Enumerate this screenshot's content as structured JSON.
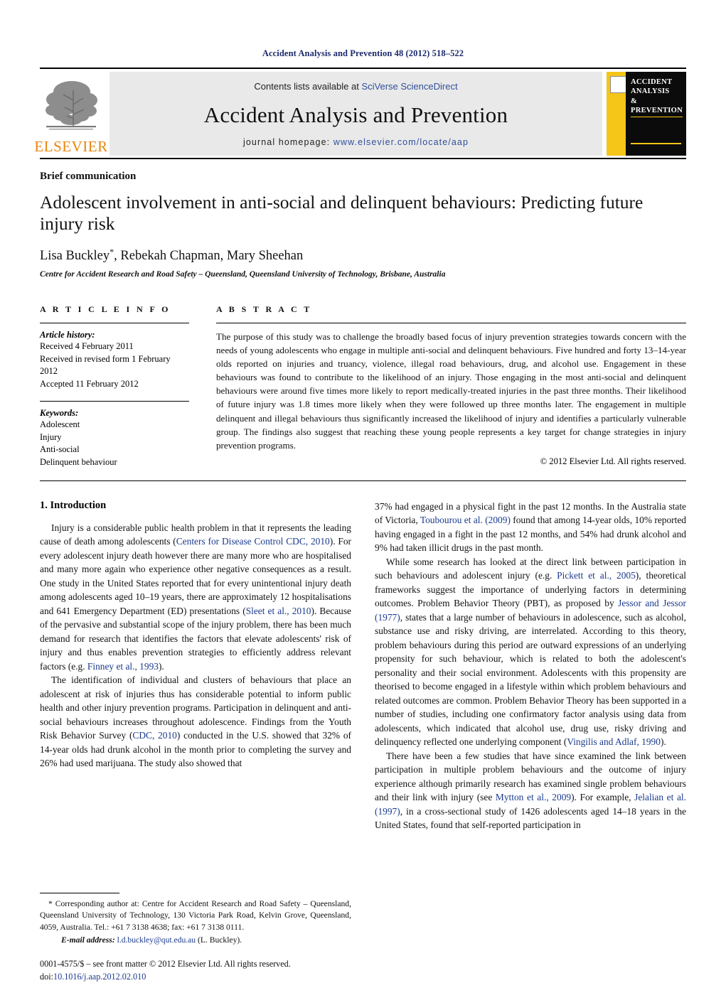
{
  "running_head": "Accident Analysis and Prevention 48 (2012) 518–522",
  "masthead": {
    "publisher_name": "ELSEVIER",
    "contents_prefix": "Contents lists available at ",
    "contents_link": "SciVerse ScienceDirect",
    "journal_title": "Accident Analysis and Prevention",
    "homepage_prefix": "journal homepage: ",
    "homepage_url": "www.elsevier.com/locate/aap",
    "cover": {
      "line1": "ACCIDENT",
      "line2": "ANALYSIS",
      "line3": "&",
      "line4": "PREVENTION"
    }
  },
  "article": {
    "type": "Brief communication",
    "title": "Adolescent involvement in anti-social and delinquent behaviours: Predicting future injury risk",
    "authors": "Lisa Buckley",
    "authors_rest": ", Rebekah Chapman, Mary Sheehan",
    "author_marker": "*",
    "affiliation": "Centre for Accident Research and Road Safety – Queensland, Queensland University of Technology, Brisbane, Australia"
  },
  "article_info": {
    "heading": "A R T I C L E    I N F O",
    "history_label": "Article history:",
    "history": [
      "Received 4 February 2011",
      "Received in revised form 1 February 2012",
      "Accepted 11 February 2012"
    ],
    "keywords_label": "Keywords:",
    "keywords": [
      "Adolescent",
      "Injury",
      "Anti-social",
      "Delinquent behaviour"
    ]
  },
  "abstract": {
    "heading": "A B S T R A C T",
    "text": "The purpose of this study was to challenge the broadly based focus of injury prevention strategies towards concern with the needs of young adolescents who engage in multiple anti-social and delinquent behaviours. Five hundred and forty 13–14-year olds reported on injuries and truancy, violence, illegal road behaviours, drug, and alcohol use. Engagement in these behaviours was found to contribute to the likelihood of an injury. Those engaging in the most anti-social and delinquent behaviours were around five times more likely to report medically-treated injuries in the past three months. Their likelihood of future injury was 1.8 times more likely when they were followed up three months later. The engagement in multiple delinquent and illegal behaviours thus significantly increased the likelihood of injury and identifies a particularly vulnerable group. The findings also suggest that reaching these young people represents a key target for change strategies in injury prevention programs.",
    "copyright": "© 2012 Elsevier Ltd. All rights reserved."
  },
  "body": {
    "section1_title": "1.  Introduction",
    "left": {
      "p1_a": "Injury is a considerable public health problem in that it represents the leading cause of death among adolescents (",
      "p1_cite1": "Centers for Disease Control CDC, 2010",
      "p1_b": "). For every adolescent injury death however there are many more who are hospitalised and many more again who experience other negative consequences as a result. One study in the United States reported that for every unintentional injury death among adolescents aged 10–19 years, there are approximately 12 hospitalisations and 641 Emergency Department (ED) presentations (",
      "p1_cite2": "Sleet et al., 2010",
      "p1_c": "). Because of the pervasive and substantial scope of the injury problem, there has been much demand for research that identifies the factors that elevate adolescents' risk of injury and thus enables prevention strategies to efficiently address relevant factors (e.g. ",
      "p1_cite3": "Finney et al., 1993",
      "p1_d": ").",
      "p2_a": "The identification of individual and clusters of behaviours that place an adolescent at risk of injuries thus has considerable potential to inform public health and other injury prevention programs. Participation in delinquent and anti-social behaviours increases throughout adolescence. Findings from the Youth Risk Behavior Survey (",
      "p2_cite1": "CDC, 2010",
      "p2_b": ") conducted in the U.S. showed that 32% of 14-year olds had drunk alcohol in the month prior to completing the survey and 26% had used marijuana. The study also showed that"
    },
    "right": {
      "p1_a": "37% had engaged in a physical fight in the past 12 months. In the Australia state of Victoria, ",
      "p1_cite1": "Toubourou et al. (2009)",
      "p1_b": " found that among 14-year olds, 10% reported having engaged in a fight in the past 12 months, and 54% had drunk alcohol and 9% had taken illicit drugs in the past month.",
      "p2_a": "While some research has looked at the direct link between participation in such behaviours and adolescent injury (e.g. ",
      "p2_cite1": "Pickett et al., 2005",
      "p2_b": "), theoretical frameworks suggest the importance of underlying factors in determining outcomes. Problem Behavior Theory (PBT), as proposed by ",
      "p2_cite2": "Jessor and Jessor (1977)",
      "p2_c": ", states that a large number of behaviours in adolescence, such as alcohol, substance use and risky driving, are interrelated. According to this theory, problem behaviours during this period are outward expressions of an underlying propensity for such behaviour, which is related to both the adolescent's personality and their social environment. Adolescents with this propensity are theorised to become engaged in a lifestyle within which problem behaviours and related outcomes are common. Problem Behavior Theory has been supported in a number of studies, including one confirmatory factor analysis using data from adolescents, which indicated that alcohol use, drug use, risky driving and delinquency reflected one underlying component (",
      "p2_cite3": "Vingilis and Adlaf, 1990",
      "p2_d": ").",
      "p3_a": "There have been a few studies that have since examined the link between participation in multiple problem behaviours and the outcome of injury experience although primarily research has examined single problem behaviours and their link with injury (see ",
      "p3_cite1": "Mytton et al., 2009",
      "p3_b": "). For example, ",
      "p3_cite2": "Jelalian et al. (1997)",
      "p3_c": ", in a cross-sectional study of 1426 adolescents aged 14–18 years in the United States, found that self-reported participation in"
    }
  },
  "footnotes": {
    "corresponding": "* Corresponding author at: Centre for Accident Research and Road Safety – Queensland, Queensland University of Technology, 130 Victoria Park Road, Kelvin Grove, Queensland, 4059, Australia. Tel.: +61 7 3138 4638; fax: +61 7 3138 0111.",
    "email_label": "E-mail address:",
    "email": "l.d.buckley@qut.edu.au",
    "email_suffix": " (L. Buckley).",
    "frontmatter": "0001-4575/$ – see front matter © 2012 Elsevier Ltd. All rights reserved.",
    "doi_label": "doi:",
    "doi": "10.1016/j.aap.2012.02.010"
  },
  "colors": {
    "link": "#1b3a8c",
    "running_head": "#1b2a6b",
    "elsevier_orange": "#e8860c",
    "cover_yellow": "#f5c518"
  }
}
